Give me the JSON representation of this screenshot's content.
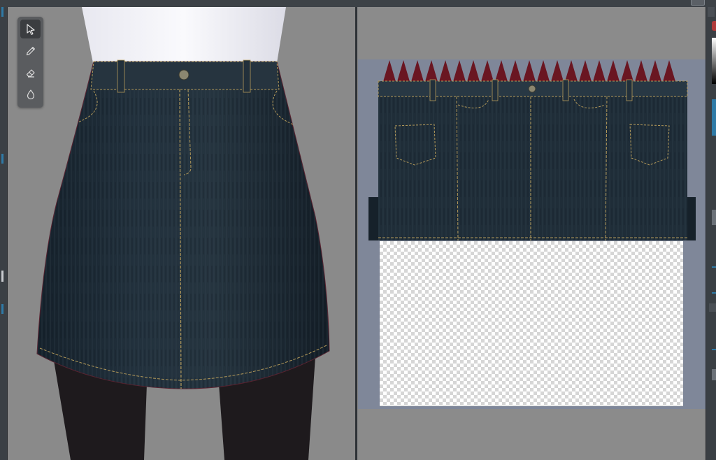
{
  "toolbar": {
    "tools": [
      {
        "name": "select",
        "icon": "cursor-arrow-icon",
        "active": true
      },
      {
        "name": "pen",
        "icon": "pencil-icon",
        "active": false
      },
      {
        "name": "eraser",
        "icon": "eraser-icon",
        "active": false
      },
      {
        "name": "fill",
        "icon": "droplet-icon",
        "active": false
      }
    ]
  },
  "colors": {
    "accent": "#2f7aa6",
    "denim": "#1d2b36",
    "stitch": "#b49a5a",
    "uv_background": "#7f8799",
    "spike": "#6a1622"
  }
}
